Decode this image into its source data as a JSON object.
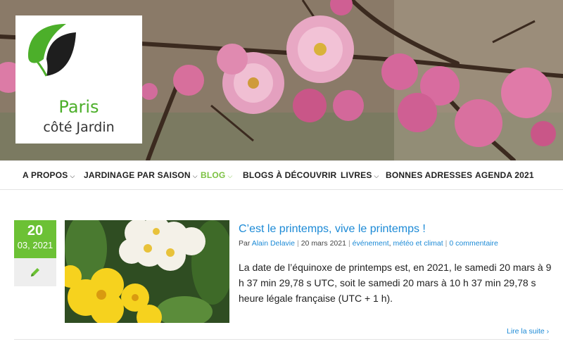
{
  "logo": {
    "line1": "Paris",
    "line2": "côté Jardin"
  },
  "nav": {
    "items": [
      {
        "label": "A PROPOS",
        "chevron": "chevron-down-icon"
      },
      {
        "label": "JARDINAGE PAR SAISON",
        "chevron": "chevron-down-icon"
      },
      {
        "label": "BLOG",
        "chevron": "chevron-down-icon",
        "active": true
      },
      {
        "label": "BLOGS À DÉCOUVRIR"
      },
      {
        "label": "LIVRES",
        "chevron": "chevron-down-icon"
      },
      {
        "label": "BONNES ADRESSES"
      },
      {
        "label": "AGENDA 2021"
      }
    ]
  },
  "post": {
    "date_day": "20",
    "date_month": "03, 2021",
    "edit_icon": "pencil-icon",
    "title": "C’est le printemps, vive le printemps !",
    "meta": {
      "by": "Par",
      "author": "Alain Delavie",
      "date": "20 mars 2021",
      "cat1": "événement",
      "cat2": "météo et climat",
      "comments": "0 commentaire"
    },
    "excerpt": "La date de l’équinoxe de printemps est, en 2021, le samedi 20 mars à 9 h 37 min 29,78 s UTC, soit le samedi 20 mars à 10 h 37 min 29,78 s heure légale française (UTC + 1 h).",
    "read_more": "Lire la suite",
    "read_more_icon": "chevron-right-icon"
  },
  "colors": {
    "accent": "#6cc135",
    "link": "#1c8ad6"
  }
}
